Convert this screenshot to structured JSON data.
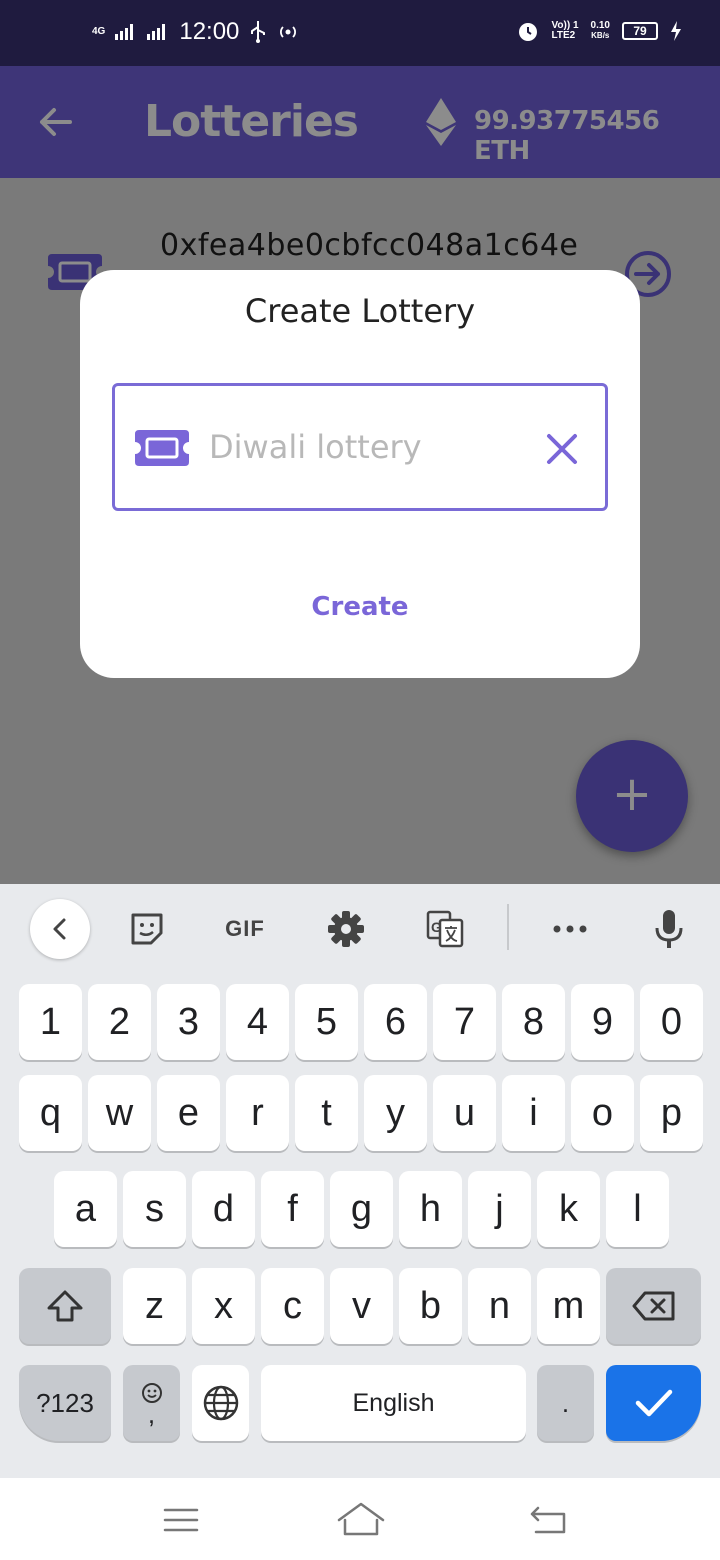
{
  "status_bar": {
    "network": "4G",
    "time": "12:00",
    "volte": "Vo)) 1",
    "lte": "LTE2",
    "speed_value": "0.10",
    "speed_unit": "KB/s",
    "battery": "79",
    "icons": [
      "usb-icon",
      "hotspot-icon",
      "alarm-icon",
      "charging-icon"
    ]
  },
  "app_bar": {
    "title": "Lotteries",
    "balance": "99.93775456 ETH",
    "back_icon": "arrow-left-icon",
    "currency_icon": "ethereum-icon"
  },
  "list": {
    "items": [
      {
        "address": "0xfea4be0cbfcc048a1c64e",
        "icon": "ticket-icon",
        "action_icon": "arrow-circle-right-icon"
      }
    ]
  },
  "dialog": {
    "title": "Create Lottery",
    "input_placeholder": "Diwali lottery",
    "input_value": "",
    "create_label": "Create",
    "accent_color": "#7a66d8"
  },
  "fab": {
    "label": "+"
  },
  "keyboard": {
    "toolbar": {
      "gif_label": "GIF"
    },
    "row_numbers": [
      "1",
      "2",
      "3",
      "4",
      "5",
      "6",
      "7",
      "8",
      "9",
      "0"
    ],
    "row_1": [
      "q",
      "w",
      "e",
      "r",
      "t",
      "y",
      "u",
      "i",
      "o",
      "p"
    ],
    "row_2": [
      "a",
      "s",
      "d",
      "f",
      "g",
      "h",
      "j",
      "k",
      "l"
    ],
    "row_3": [
      "z",
      "x",
      "c",
      "v",
      "b",
      "n",
      "m"
    ],
    "symbols_label": "?123",
    "comma_label": ",",
    "space_label": "English",
    "period_label": ".",
    "enter_color": "#1a73e8"
  }
}
